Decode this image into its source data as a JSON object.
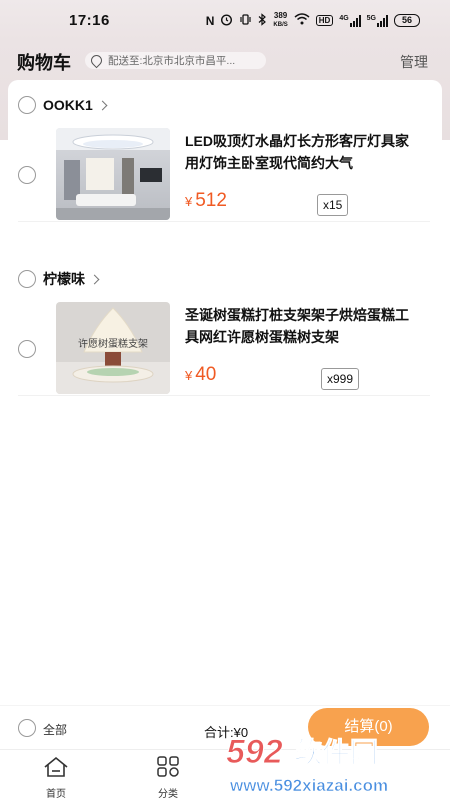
{
  "status_bar": {
    "time": "17:16",
    "net_speed_top": "389",
    "net_speed_unit": "KB/S",
    "hd_label": "HD",
    "sim1_label": "4G",
    "sim2_label": "5G",
    "battery": "56"
  },
  "header": {
    "title": "购物车",
    "address": "配送至:北京市北京市昌平...",
    "manage_label": "管理"
  },
  "stores": [
    {
      "name": "OOKK1",
      "item": {
        "name": "LED吸顶灯水晶灯长方形客厅灯具家用灯饰主卧室现代简约大气",
        "currency": "¥",
        "price": "512",
        "qty": "x15"
      }
    },
    {
      "name": "柠檬味",
      "item": {
        "name": "圣诞树蛋糕打桩支架架子烘焙蛋糕工具网红许愿树蛋糕树支架",
        "currency": "¥",
        "price": "40",
        "qty": "x999",
        "image_caption": "许愿树蛋糕支架"
      }
    }
  ],
  "footer": {
    "select_all_label": "全部",
    "total_label": "合计:¥0",
    "checkout_label": "结算(0)"
  },
  "tabs": [
    {
      "label": "首页",
      "icon": "home-icon"
    },
    {
      "label": "分类",
      "icon": "category-icon"
    }
  ],
  "watermark": {
    "number": "592",
    "brand": "软件园",
    "url": "www.592xiazai.com"
  },
  "colors": {
    "price": "#f05a23",
    "checkout": "#f8a24e",
    "header_bg": "#ebe3e4"
  }
}
